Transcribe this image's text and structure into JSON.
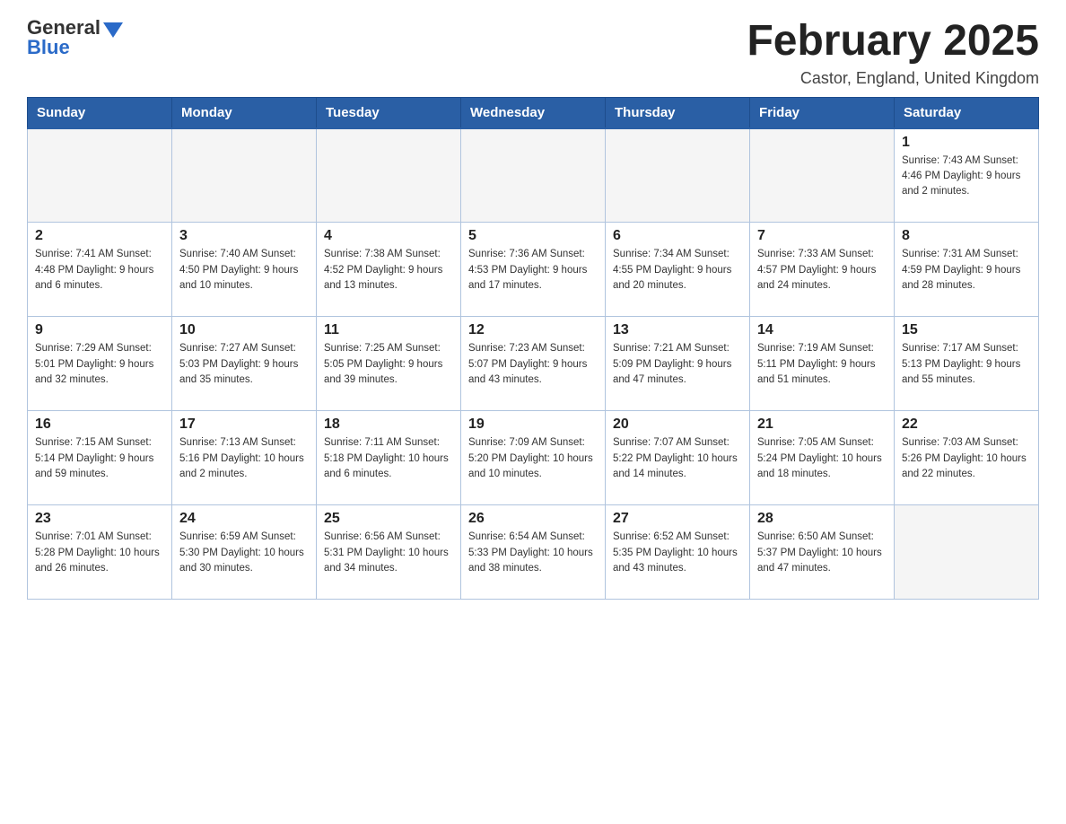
{
  "logo": {
    "general": "General",
    "blue": "Blue"
  },
  "title": "February 2025",
  "location": "Castor, England, United Kingdom",
  "days_of_week": [
    "Sunday",
    "Monday",
    "Tuesday",
    "Wednesday",
    "Thursday",
    "Friday",
    "Saturday"
  ],
  "weeks": [
    [
      {
        "day": "",
        "info": ""
      },
      {
        "day": "",
        "info": ""
      },
      {
        "day": "",
        "info": ""
      },
      {
        "day": "",
        "info": ""
      },
      {
        "day": "",
        "info": ""
      },
      {
        "day": "",
        "info": ""
      },
      {
        "day": "1",
        "info": "Sunrise: 7:43 AM\nSunset: 4:46 PM\nDaylight: 9 hours and 2 minutes."
      }
    ],
    [
      {
        "day": "2",
        "info": "Sunrise: 7:41 AM\nSunset: 4:48 PM\nDaylight: 9 hours and 6 minutes."
      },
      {
        "day": "3",
        "info": "Sunrise: 7:40 AM\nSunset: 4:50 PM\nDaylight: 9 hours and 10 minutes."
      },
      {
        "day": "4",
        "info": "Sunrise: 7:38 AM\nSunset: 4:52 PM\nDaylight: 9 hours and 13 minutes."
      },
      {
        "day": "5",
        "info": "Sunrise: 7:36 AM\nSunset: 4:53 PM\nDaylight: 9 hours and 17 minutes."
      },
      {
        "day": "6",
        "info": "Sunrise: 7:34 AM\nSunset: 4:55 PM\nDaylight: 9 hours and 20 minutes."
      },
      {
        "day": "7",
        "info": "Sunrise: 7:33 AM\nSunset: 4:57 PM\nDaylight: 9 hours and 24 minutes."
      },
      {
        "day": "8",
        "info": "Sunrise: 7:31 AM\nSunset: 4:59 PM\nDaylight: 9 hours and 28 minutes."
      }
    ],
    [
      {
        "day": "9",
        "info": "Sunrise: 7:29 AM\nSunset: 5:01 PM\nDaylight: 9 hours and 32 minutes."
      },
      {
        "day": "10",
        "info": "Sunrise: 7:27 AM\nSunset: 5:03 PM\nDaylight: 9 hours and 35 minutes."
      },
      {
        "day": "11",
        "info": "Sunrise: 7:25 AM\nSunset: 5:05 PM\nDaylight: 9 hours and 39 minutes."
      },
      {
        "day": "12",
        "info": "Sunrise: 7:23 AM\nSunset: 5:07 PM\nDaylight: 9 hours and 43 minutes."
      },
      {
        "day": "13",
        "info": "Sunrise: 7:21 AM\nSunset: 5:09 PM\nDaylight: 9 hours and 47 minutes."
      },
      {
        "day": "14",
        "info": "Sunrise: 7:19 AM\nSunset: 5:11 PM\nDaylight: 9 hours and 51 minutes."
      },
      {
        "day": "15",
        "info": "Sunrise: 7:17 AM\nSunset: 5:13 PM\nDaylight: 9 hours and 55 minutes."
      }
    ],
    [
      {
        "day": "16",
        "info": "Sunrise: 7:15 AM\nSunset: 5:14 PM\nDaylight: 9 hours and 59 minutes."
      },
      {
        "day": "17",
        "info": "Sunrise: 7:13 AM\nSunset: 5:16 PM\nDaylight: 10 hours and 2 minutes."
      },
      {
        "day": "18",
        "info": "Sunrise: 7:11 AM\nSunset: 5:18 PM\nDaylight: 10 hours and 6 minutes."
      },
      {
        "day": "19",
        "info": "Sunrise: 7:09 AM\nSunset: 5:20 PM\nDaylight: 10 hours and 10 minutes."
      },
      {
        "day": "20",
        "info": "Sunrise: 7:07 AM\nSunset: 5:22 PM\nDaylight: 10 hours and 14 minutes."
      },
      {
        "day": "21",
        "info": "Sunrise: 7:05 AM\nSunset: 5:24 PM\nDaylight: 10 hours and 18 minutes."
      },
      {
        "day": "22",
        "info": "Sunrise: 7:03 AM\nSunset: 5:26 PM\nDaylight: 10 hours and 22 minutes."
      }
    ],
    [
      {
        "day": "23",
        "info": "Sunrise: 7:01 AM\nSunset: 5:28 PM\nDaylight: 10 hours and 26 minutes."
      },
      {
        "day": "24",
        "info": "Sunrise: 6:59 AM\nSunset: 5:30 PM\nDaylight: 10 hours and 30 minutes."
      },
      {
        "day": "25",
        "info": "Sunrise: 6:56 AM\nSunset: 5:31 PM\nDaylight: 10 hours and 34 minutes."
      },
      {
        "day": "26",
        "info": "Sunrise: 6:54 AM\nSunset: 5:33 PM\nDaylight: 10 hours and 38 minutes."
      },
      {
        "day": "27",
        "info": "Sunrise: 6:52 AM\nSunset: 5:35 PM\nDaylight: 10 hours and 43 minutes."
      },
      {
        "day": "28",
        "info": "Sunrise: 6:50 AM\nSunset: 5:37 PM\nDaylight: 10 hours and 47 minutes."
      },
      {
        "day": "",
        "info": ""
      }
    ]
  ]
}
